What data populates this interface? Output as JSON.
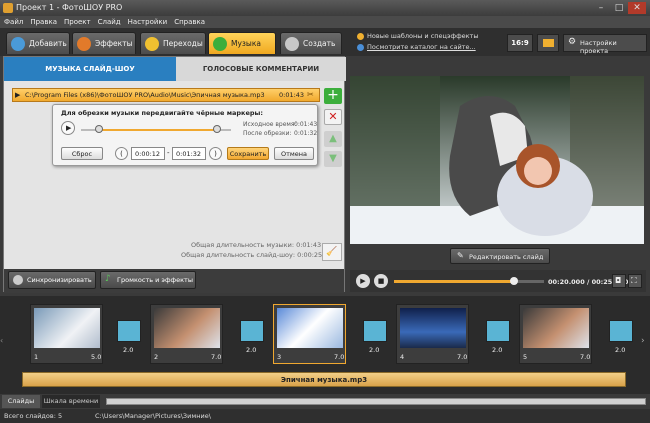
{
  "window": {
    "title": "Проект 1 - ФотоШОУ PRO"
  },
  "menu": [
    "Файл",
    "Правка",
    "Проект",
    "Слайд",
    "Настройки",
    "Справка"
  ],
  "tabs": [
    {
      "label": "Добавить"
    },
    {
      "label": "Эффекты"
    },
    {
      "label": "Переходы"
    },
    {
      "label": "Музыка"
    },
    {
      "label": "Создать"
    }
  ],
  "top_links": {
    "link1": "Новые шаблоны и спецэффекты",
    "link2": "Посмотрите каталог на сайте..."
  },
  "aspect": "16:9",
  "project_settings": "Настройки проекта",
  "subtabs": {
    "music": "МУЗЫКА СЛАЙД-ШОУ",
    "voice": "ГОЛОСОВЫЕ КОММЕНТАРИИ"
  },
  "track": {
    "path": "C:\\Program Files (x86)\\ФотоШОУ PRO\\Audio\\Music\\Эпичная музыка.mp3",
    "time": "0:01:43"
  },
  "trim": {
    "title": "Для обрезки музыки передвигайте чёрные маркеры:",
    "orig_label": "Исходное время:",
    "orig_value": "0:01:43",
    "cut_label": "После обрезки:",
    "cut_value": "0:01:32",
    "reset": "Сброс",
    "start": "0:00:12",
    "end": "0:01:32",
    "save": "Сохранить",
    "cancel": "Отмена"
  },
  "durations": {
    "music": "Общая длительность музыки: 0:01:43",
    "slideshow": "Общая длительность слайд-шоу: 0:00:25"
  },
  "bottom_buttons": {
    "sync": "Синхронизировать",
    "volume": "Громкость и эффекты"
  },
  "edit_slide": "Редактировать слайд",
  "playback": {
    "time": "00:20.000 / 00:25.000",
    "progress": 0.8
  },
  "slides": [
    {
      "num": "1",
      "dur": "5.0",
      "trans": "2.0"
    },
    {
      "num": "2",
      "dur": "7.0",
      "trans": "2.0"
    },
    {
      "num": "3",
      "dur": "7.0",
      "trans": "2.0"
    },
    {
      "num": "4",
      "dur": "7.0",
      "trans": "2.0"
    },
    {
      "num": "5",
      "dur": "7.0",
      "trans": "2.0"
    }
  ],
  "music_track": "Эпичная музыка.mp3",
  "view_tabs": {
    "slides": "Слайды",
    "timeline": "Шкала времени"
  },
  "status": {
    "count": "Всего слайдов: 5",
    "path": "C:\\Users\\Manager\\Pictures\\Зимние\\"
  }
}
